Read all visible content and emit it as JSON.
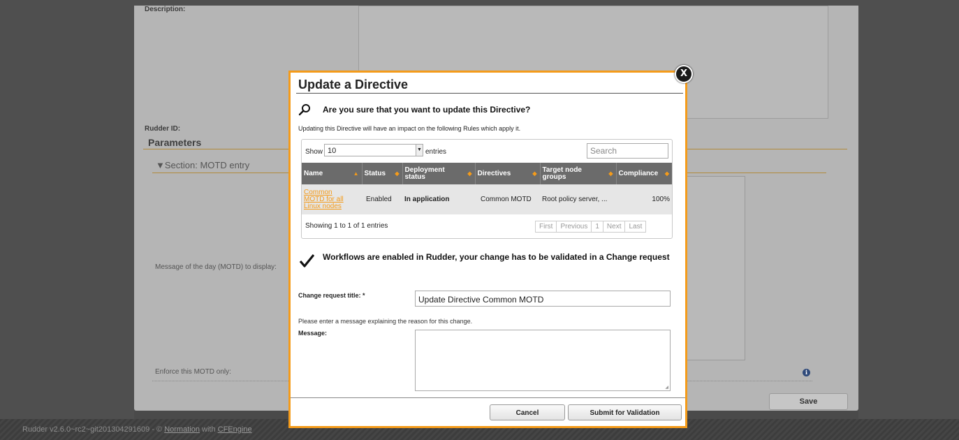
{
  "background": {
    "description_label": "Description:",
    "rudder_id_label": "Rudder ID:",
    "parameters_title": "Parameters",
    "section_title": "▼Section: MOTD entry",
    "motd_label": "Message of the day (MOTD) to display:",
    "enforce_label": "Enforce this MOTD only:",
    "save_label": "Save"
  },
  "footer": {
    "version_text": "Rudder v2.6.0~rc2~git201304291609 - © ",
    "normation_link": "Normation",
    "with_text": " with ",
    "cfengine_link": "CFEngine"
  },
  "modal": {
    "title": "Update a Directive",
    "close_glyph": "X",
    "question": "Are you sure that you want to update this Directive?",
    "impact_text": "Updating this Directive will have an impact on the following Rules which apply it.",
    "table": {
      "show_label": "Show",
      "page_size": "10",
      "entries_label": "entries",
      "search_placeholder": "Search",
      "columns": [
        "Name",
        "Status",
        "Deployment status",
        "Directives",
        "Target node groups",
        "Compliance"
      ],
      "rows": [
        {
          "name": "Common MOTD for all Linux nodes",
          "status": "Enabled",
          "deployment": "In application",
          "directives": "Common MOTD",
          "targets": "Root policy server, ...",
          "compliance": "100%"
        }
      ],
      "showing_text": "Showing 1 to 1 of 1 entries",
      "pager": [
        "First",
        "Previous",
        "1",
        "Next",
        "Last"
      ]
    },
    "workflow_text": "Workflows are enabled in Rudder, your change has to be validated in a Change request",
    "cr_title_label": "Change request title: *",
    "cr_title_value": "Update Directive Common MOTD",
    "message_hint": "Please enter a message explaining the reason for this change.",
    "message_label": "Message:",
    "message_value": "",
    "cancel_label": "Cancel",
    "submit_label": "Submit for Validation"
  },
  "colors": {
    "accent": "#f49b1a",
    "table_header": "#6b6b6b"
  }
}
